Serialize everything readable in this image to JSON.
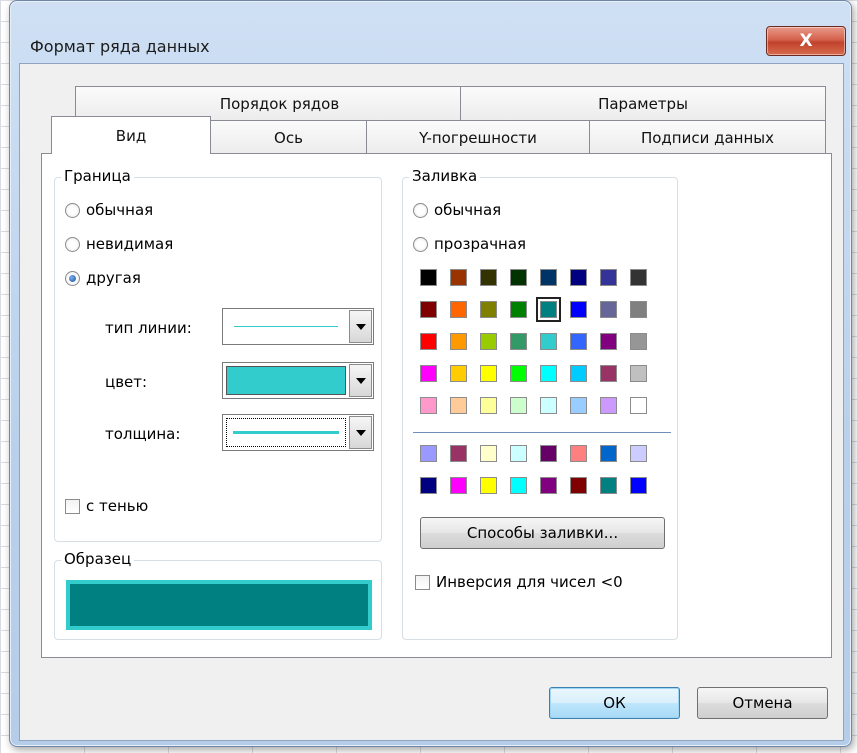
{
  "dialog": {
    "title": "Формат ряда данных",
    "close_label": "X"
  },
  "tabs_back": [
    {
      "label": "Порядок рядов"
    },
    {
      "label": "Параметры"
    }
  ],
  "tabs_front": [
    {
      "label": "Вид",
      "active": true
    },
    {
      "label": "Ось"
    },
    {
      "label": "Y-погрешности"
    },
    {
      "label": "Подписи данных"
    }
  ],
  "border": {
    "group_label": "Граница",
    "options": [
      {
        "label": "обычная",
        "selected": false
      },
      {
        "label": "невидимая",
        "selected": false
      },
      {
        "label": "другая",
        "selected": true
      }
    ],
    "line_type_label": "тип линии:",
    "color_label": "цвет:",
    "weight_label": "толщина:",
    "current_color": "#33cccc",
    "shadow_label": "с тенью",
    "shadow_checked": false
  },
  "sample": {
    "group_label": "Образец",
    "fill_color": "#008080",
    "border_color": "#33cccc"
  },
  "fill": {
    "group_label": "Заливка",
    "options": [
      {
        "label": "обычная",
        "selected": false
      },
      {
        "label": "прозрачная",
        "selected": false
      }
    ],
    "palette": [
      "#000000",
      "#993300",
      "#333300",
      "#003300",
      "#003366",
      "#000080",
      "#333399",
      "#333333",
      "#800000",
      "#ff6600",
      "#808000",
      "#008000",
      "#008080",
      "#0000ff",
      "#666699",
      "#808080",
      "#ff0000",
      "#ff9900",
      "#99cc00",
      "#339966",
      "#33cccc",
      "#3366ff",
      "#800080",
      "#969696",
      "#ff00ff",
      "#ffcc00",
      "#ffff00",
      "#00ff00",
      "#00ffff",
      "#00ccff",
      "#993366",
      "#c0c0c0",
      "#ff99cc",
      "#ffcc99",
      "#ffff99",
      "#ccffcc",
      "#ccffff",
      "#99ccff",
      "#cc99ff",
      "#ffffff"
    ],
    "selected_color": "#008080",
    "palette_extra": [
      "#9999ff",
      "#993366",
      "#ffffcc",
      "#ccffff",
      "#660066",
      "#ff8080",
      "#0066cc",
      "#ccccff",
      "#000080",
      "#ff00ff",
      "#ffff00",
      "#00ffff",
      "#800080",
      "#800000",
      "#008080",
      "#0000ff"
    ],
    "fill_effects_label": "Способы заливки...",
    "invert_label": "Инверсия для чисел <0",
    "invert_checked": false
  },
  "buttons": {
    "ok": "ОК",
    "cancel": "Отмена"
  }
}
